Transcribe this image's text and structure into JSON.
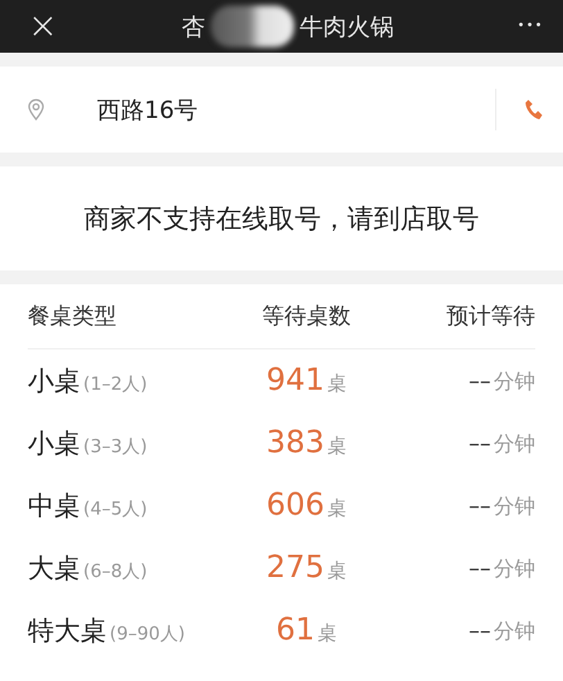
{
  "header": {
    "close_icon": "×",
    "title_start": "杏",
    "title_end": "牛肉火锅",
    "more_icon": "•••"
  },
  "address": {
    "text": "西路16号"
  },
  "notice": "商家不支持在线取号，请到店取号",
  "table": {
    "columns": [
      "餐桌类型",
      "等待桌数",
      "预计等待"
    ],
    "rows": [
      {
        "type": "小桌",
        "range": "(1–2人)",
        "count": "941",
        "count_unit": "桌",
        "wait": "––",
        "wait_unit": "分钟"
      },
      {
        "type": "小桌",
        "range": "(3–3人)",
        "count": "383",
        "count_unit": "桌",
        "wait": "––",
        "wait_unit": "分钟"
      },
      {
        "type": "中桌",
        "range": "(4–5人)",
        "count": "606",
        "count_unit": "桌",
        "wait": "––",
        "wait_unit": "分钟"
      },
      {
        "type": "大桌",
        "range": "(6–8人)",
        "count": "275",
        "count_unit": "桌",
        "wait": "––",
        "wait_unit": "分钟"
      },
      {
        "type": "特大桌",
        "range": "(9–90人)",
        "count": "61",
        "count_unit": "桌",
        "wait": "––",
        "wait_unit": "分钟"
      }
    ]
  }
}
